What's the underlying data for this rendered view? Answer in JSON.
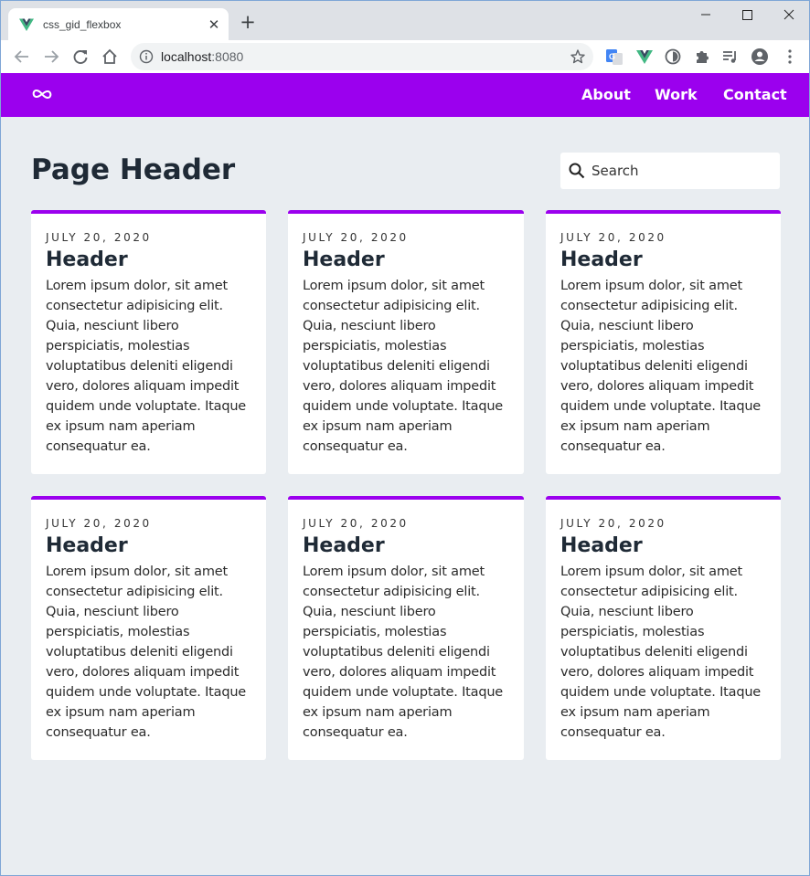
{
  "browser": {
    "tab_title": "css_gid_flexbox",
    "tab_close": "✕",
    "new_tab": "+",
    "url_host": "localhost",
    "url_port": ":8080"
  },
  "colors": {
    "accent": "#9b00ee",
    "page_bg": "#e9edf1",
    "title": "#1f2a36"
  },
  "nav": {
    "logo_icon": "infinity-icon",
    "links": [
      "About",
      "Work",
      "Contact"
    ]
  },
  "main": {
    "title": "Page Header",
    "search_placeholder": "Search"
  },
  "cards": [
    {
      "date": "JULY 20, 2020",
      "header": "Header",
      "body": "Lorem ipsum dolor, sit amet consectetur adipisicing elit. Quia, nesciunt libero perspiciatis, molestias voluptatibus deleniti eligendi vero, dolores aliquam impedit quidem unde voluptate. Itaque ex ipsum nam aperiam consequatur ea."
    },
    {
      "date": "JULY 20, 2020",
      "header": "Header",
      "body": "Lorem ipsum dolor, sit amet consectetur adipisicing elit. Quia, nesciunt libero perspiciatis, molestias voluptatibus deleniti eligendi vero, dolores aliquam impedit quidem unde voluptate. Itaque ex ipsum nam aperiam consequatur ea."
    },
    {
      "date": "JULY 20, 2020",
      "header": "Header",
      "body": "Lorem ipsum dolor, sit amet consectetur adipisicing elit. Quia, nesciunt libero perspiciatis, molestias voluptatibus deleniti eligendi vero, dolores aliquam impedit quidem unde voluptate. Itaque ex ipsum nam aperiam consequatur ea."
    },
    {
      "date": "JULY 20, 2020",
      "header": "Header",
      "body": "Lorem ipsum dolor, sit amet consectetur adipisicing elit. Quia, nesciunt libero perspiciatis, molestias voluptatibus deleniti eligendi vero, dolores aliquam impedit quidem unde voluptate. Itaque ex ipsum nam aperiam consequatur ea."
    },
    {
      "date": "JULY 20, 2020",
      "header": "Header",
      "body": "Lorem ipsum dolor, sit amet consectetur adipisicing elit. Quia, nesciunt libero perspiciatis, molestias voluptatibus deleniti eligendi vero, dolores aliquam impedit quidem unde voluptate. Itaque ex ipsum nam aperiam consequatur ea."
    },
    {
      "date": "JULY 20, 2020",
      "header": "Header",
      "body": "Lorem ipsum dolor, sit amet consectetur adipisicing elit. Quia, nesciunt libero perspiciatis, molestias voluptatibus deleniti eligendi vero, dolores aliquam impedit quidem unde voluptate. Itaque ex ipsum nam aperiam consequatur ea."
    }
  ]
}
